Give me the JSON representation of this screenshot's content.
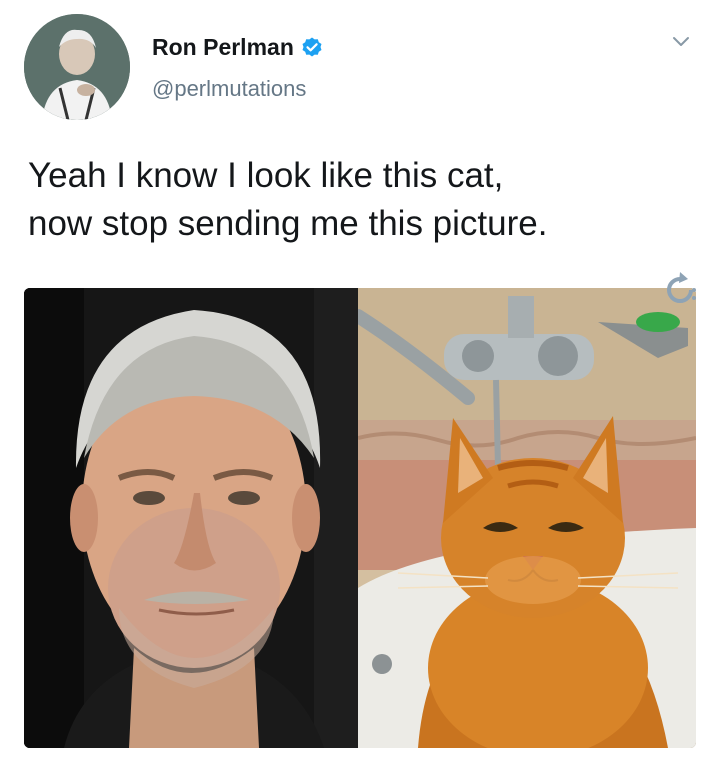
{
  "tweet": {
    "author": {
      "display_name": "Ron Perlman",
      "handle": "@perlmutations",
      "verified": true,
      "avatar_icon": "profile-avatar"
    },
    "text": "Yeah I know I look like this cat,\nnow stop sending me this picture.",
    "menu_icon": "chevron-down-icon",
    "media": {
      "images": [
        {
          "subject": "portrait-man"
        },
        {
          "subject": "orange-cat-in-sink"
        }
      ]
    }
  },
  "colors": {
    "text_primary": "#14171a",
    "text_secondary": "#657786",
    "verified_blue": "#1da1f2",
    "background": "#ffffff"
  }
}
